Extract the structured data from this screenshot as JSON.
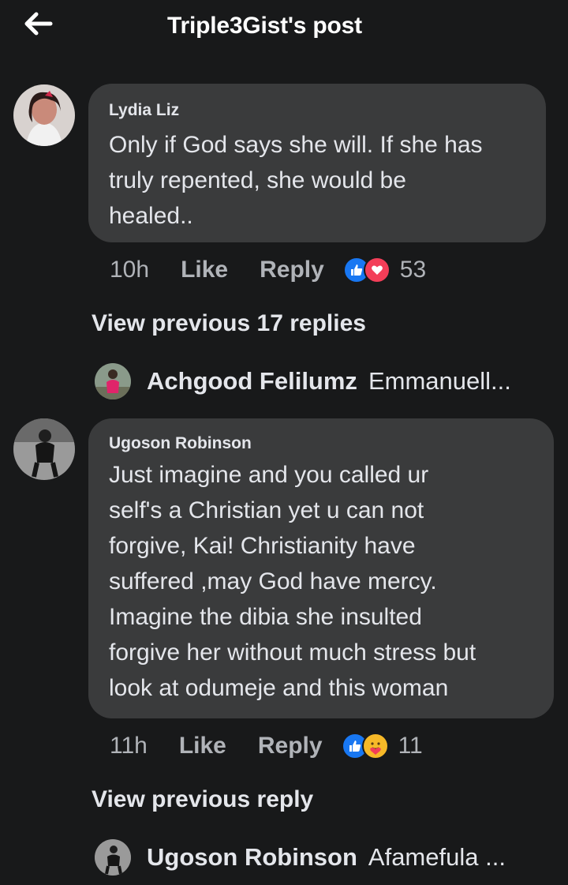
{
  "header": {
    "title": "Triple3Gist's post",
    "back_icon": "arrow-left-icon"
  },
  "comments": [
    {
      "author": "Lydia Liz",
      "text": "Only if God says she will. If she has\ntruly repented, she would be\nhealed..",
      "time": "10h",
      "like_label": "Like",
      "reply_label": "Reply",
      "reactions": [
        "like-icon",
        "love-icon"
      ],
      "reaction_count": "53",
      "view_previous": "View previous 17 replies",
      "latest_reply": {
        "author": "Achgood Felilumz",
        "preview": "Emmanuell..."
      }
    },
    {
      "author": "Ugoson Robinson",
      "text": "Just imagine and you called ur\nself's a Christian yet u can not\nforgive, Kai! Christianity have\nsuffered ,may God have mercy.\nImagine the dibia she insulted\nforgive her without much stress but\nlook at odumeje and this woman",
      "time": "11h",
      "like_label": "Like",
      "reply_label": "Reply",
      "reactions": [
        "like-icon",
        "care-icon"
      ],
      "reaction_count": "11",
      "view_previous": "View previous reply",
      "latest_reply": {
        "author": "Ugoson Robinson",
        "preview": "Afamefula ..."
      }
    }
  ],
  "colors": {
    "background": "#18191a",
    "bubble": "#3a3b3c",
    "text": "#e4e6eb",
    "muted": "#b0b3b8",
    "like_blue": "#1877f2",
    "love_red": "#f33e58",
    "care_yellow": "#f7b928"
  }
}
